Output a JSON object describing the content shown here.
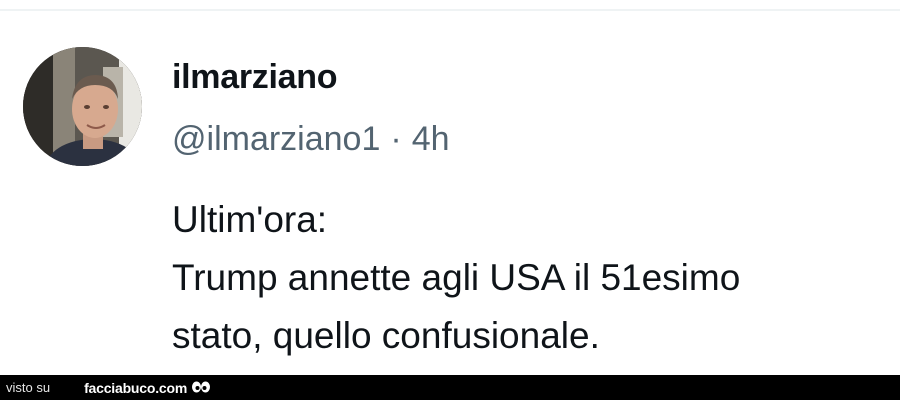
{
  "tweet": {
    "display_name": "ilmarziano",
    "handle": "@ilmarziano1",
    "separator": "·",
    "time": "4h",
    "text_lines": [
      "Ultim'ora:",
      "Trump annette agli USA il 51esimo",
      "stato, quello confusionale."
    ],
    "avatar_icon": "profile-photo"
  },
  "watermark": {
    "prefix": "visto su",
    "site": "facciabuco.com",
    "logo_icon": "eyes-icon"
  }
}
